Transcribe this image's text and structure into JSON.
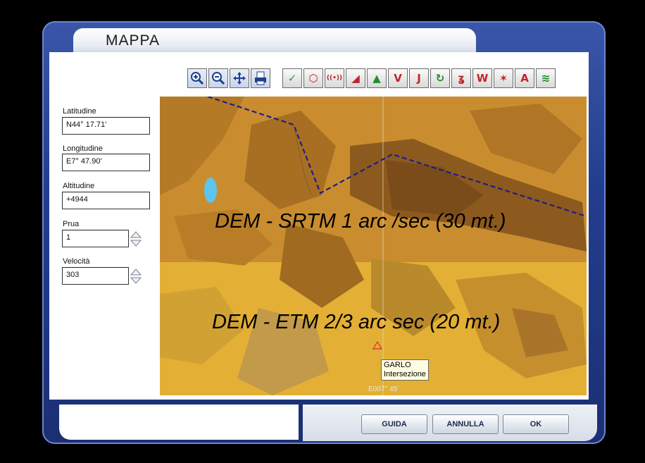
{
  "window": {
    "title": "MAPPA"
  },
  "toolbar": {
    "nav_tools": [
      "zoom-in-icon",
      "zoom-out-icon",
      "pan-icon",
      "print-icon"
    ],
    "layer_tools": [
      {
        "name": "airport-icon",
        "glyph": "✓",
        "color": "#2e9a2e"
      },
      {
        "name": "vor-icon",
        "glyph": "⬡",
        "color": "#c0242a"
      },
      {
        "name": "ndb-icon",
        "glyph": "((•))",
        "color": "#c0242a"
      },
      {
        "name": "intersection-icon",
        "glyph": "◢",
        "color": "#c0242a"
      },
      {
        "name": "waypoint-icon",
        "glyph": "▲",
        "color": "#1f8f2e"
      },
      {
        "name": "victor-airway-icon",
        "glyph": "V",
        "color": "#c0242a"
      },
      {
        "name": "jet-airway-icon",
        "glyph": "J",
        "color": "#c0242a"
      },
      {
        "name": "holding-icon",
        "glyph": "↻",
        "color": "#1f8f2e"
      },
      {
        "name": "route-icon",
        "glyph": "ʓ",
        "color": "#c0242a"
      },
      {
        "name": "weather-icon",
        "glyph": "W",
        "color": "#c0242a"
      },
      {
        "name": "airspace-icon",
        "glyph": "✶",
        "color": "#c0242a"
      },
      {
        "name": "labels-icon",
        "glyph": "A",
        "color": "#c0242a"
      },
      {
        "name": "terrain-icon",
        "glyph": "≋",
        "color": "#1f8f2e"
      }
    ]
  },
  "fields": {
    "latitude": {
      "label": "Latitudine",
      "value": "N44° 17.71'"
    },
    "longitude": {
      "label": "Longitudine",
      "value": "E7° 47.90'"
    },
    "altitude": {
      "label": "Altitudine",
      "value": "+4944"
    },
    "heading": {
      "label": "Prua",
      "value": "1"
    },
    "speed": {
      "label": "Velocità",
      "value": "303"
    }
  },
  "map": {
    "overlay_top": "DEM - SRTM 1 arc /sec (30 mt.)",
    "overlay_bottom": "DEM - ETM 2/3 arc sec (20 mt.)",
    "tooltip_name": "GARLO",
    "tooltip_type": "Intersezione",
    "grid_label": "E007° 45'"
  },
  "buttons": {
    "guide": "GUIDA",
    "cancel": "ANNULLA",
    "ok": "OK"
  }
}
